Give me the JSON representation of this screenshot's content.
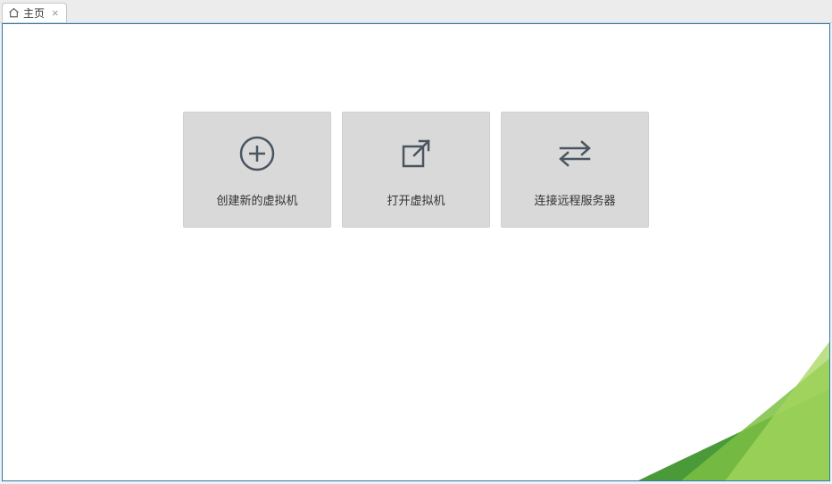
{
  "tab": {
    "title": "主页"
  },
  "cards": {
    "create": {
      "label": "创建新的虚拟机"
    },
    "open": {
      "label": "打开虚拟机"
    },
    "connect": {
      "label": "连接远程服务器"
    }
  }
}
